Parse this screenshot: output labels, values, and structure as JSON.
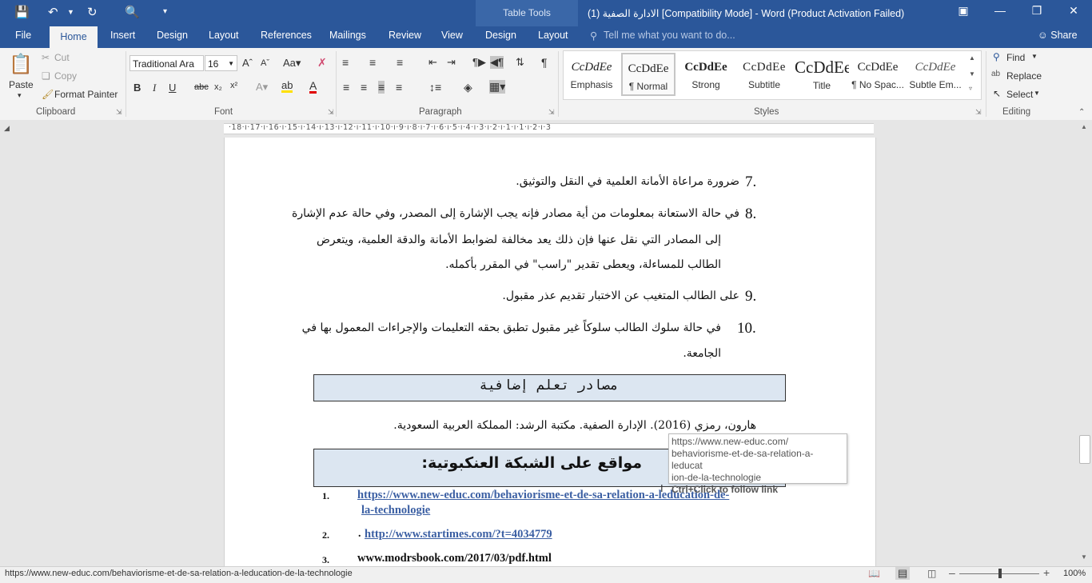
{
  "titlebar": {
    "context_tab_group": "Table Tools",
    "document_title": "(1) الادارة الصفية [Compatibility Mode] - Word (Product Activation Failed)"
  },
  "tabs": [
    "File",
    "Home",
    "Insert",
    "Design",
    "Layout",
    "References",
    "Mailings",
    "Review",
    "View",
    "Design",
    "Layout"
  ],
  "active_tab": "Home",
  "tell_me_placeholder": "Tell me what you want to do...",
  "share_label": "Share",
  "clipboard": {
    "paste": "Paste",
    "cut": "Cut",
    "copy": "Copy",
    "format_painter": "Format Painter",
    "group_label": "Clipboard"
  },
  "font": {
    "family": "Traditional Ara",
    "size": "16",
    "group_label": "Font"
  },
  "paragraph": {
    "group_label": "Paragraph"
  },
  "styles": {
    "group_label": "Styles",
    "items": [
      {
        "preview": "CcDdEe",
        "name": "Emphasis"
      },
      {
        "preview": "CcDdEe",
        "name": "¶ Normal"
      },
      {
        "preview": "CcDdEe",
        "name": "Strong"
      },
      {
        "preview": "CcDdEe",
        "name": "Subtitle"
      },
      {
        "preview": "CcDdEe",
        "name": "Title"
      },
      {
        "preview": "CcDdEe",
        "name": "¶ No Spac..."
      },
      {
        "preview": "CcDdEe",
        "name": "Subtle Em..."
      }
    ]
  },
  "editing": {
    "find": "Find",
    "replace": "Replace",
    "select": "Select",
    "group_label": "Editing"
  },
  "ruler": "·18·ı·17·ı·16·ı·15·ı·14·ı·13·ı·12·ı·11·ı·10·ı·9·ı·8·ı·7·ı·6·ı·5·ı·4·ı·3·ı·2·ı·1·ı·1·ı·2·ı·3",
  "document": {
    "items": [
      {
        "num": "7.",
        "lines": [
          "ضرورة مراعاة الأمانة العلمية في النقل والتوثيق."
        ]
      },
      {
        "num": "8.",
        "lines": [
          "في حالة الاستعانة بمعلومات من أية مصادر فإنه يجب الإشارة إلى المصدر، وفي حالة عدم الإشارة",
          "إلى المصادر التي نقل عنها فإن ذلك يعد مخالفة لضوابط الأمانة والدقة العلمية، ويتعرض",
          "الطالب للمساءلة، ويعطى تقدير \"راسب\" في المقرر بأكمله."
        ]
      },
      {
        "num": "9.",
        "lines": [
          "على الطالب المتغيب عن الاختبار تقديم عذر مقبول."
        ]
      },
      {
        "num": "10.",
        "lines": [
          "في حالة سلوك الطالب سلوكاً غير مقبول تطبق بحقه التعليمات والإجراءات المعمول بها في",
          "الجامعة."
        ]
      }
    ],
    "sources_heading": "مصادر تعلم إضافية",
    "reference": "هارون، رمزي (2016). الإدارة الصفية. مكتبة الرشد: المملكة العربية السعودية.",
    "web_heading": "مواقع على الشبكة العنكبوتية:",
    "links": [
      {
        "num": "1.",
        "text_line1": "https://www.new-educ.com/behaviorisme-et-de-sa-relation-a-leducation-de-",
        "text_line2": "la-technologie"
      },
      {
        "num": "2.",
        "prefix": ".",
        "text": "http://www.startimes.com/?t=4034779"
      },
      {
        "num": "3.",
        "text": "www.modrsbook.com/2017/03/pdf.html"
      }
    ]
  },
  "tooltip": {
    "lines": [
      "https://www.new-educ.com/",
      "behaviorisme-et-de-sa-relation-a-leducat",
      "ion-de-la-technologie"
    ],
    "hint": "Ctrl+Click to follow link"
  },
  "statusbar": {
    "url": "https://www.new-educ.com/behaviorisme-et-de-sa-relation-a-leducation-de-la-technologie",
    "zoom": "100%"
  },
  "colors": {
    "accent": "#2b579a",
    "heading_fill": "#dce6f1",
    "link": "#3b5fa3"
  }
}
